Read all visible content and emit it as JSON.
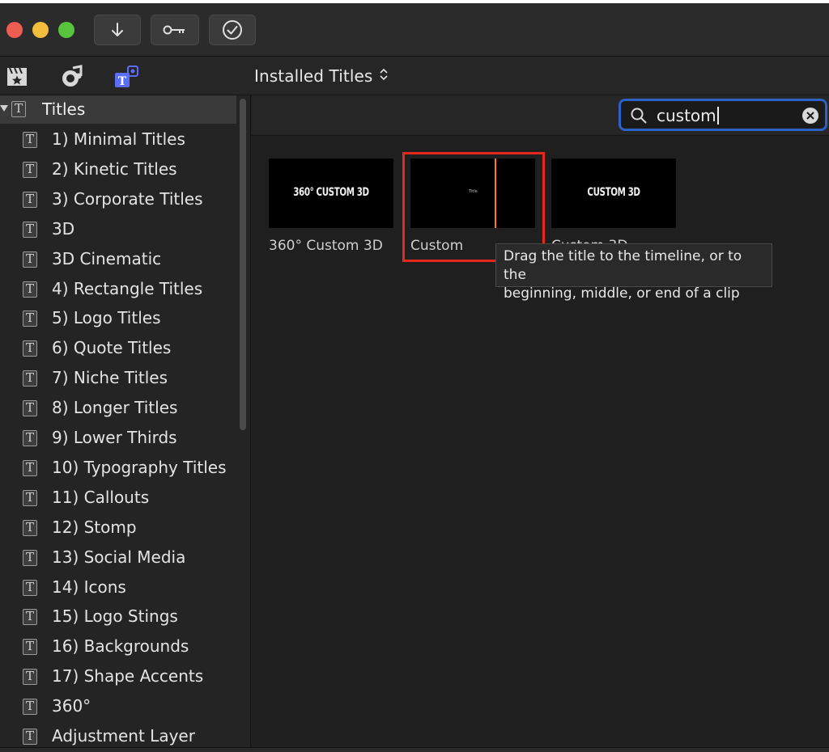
{
  "toolbar": {
    "buttons": [
      {
        "name": "import-button",
        "icon": "down-arrow-icon"
      },
      {
        "name": "keywords-button",
        "icon": "key-icon"
      },
      {
        "name": "background-tasks-button",
        "icon": "checkmark-circle-icon"
      }
    ]
  },
  "header": {
    "icons": [
      "photos-clapper-icon",
      "music-sound-icon",
      "titles-generators-icon"
    ],
    "browser_label": "Installed Titles"
  },
  "sidebar": {
    "root_label": "Titles",
    "items": [
      {
        "label": "1) Minimal Titles"
      },
      {
        "label": "2) Kinetic Titles"
      },
      {
        "label": "3) Corporate Titles"
      },
      {
        "label": "3D"
      },
      {
        "label": "3D Cinematic"
      },
      {
        "label": "4) Rectangle Titles"
      },
      {
        "label": "5) Logo Titles"
      },
      {
        "label": "6) Quote Titles"
      },
      {
        "label": "7) Niche Titles"
      },
      {
        "label": "8) Longer Titles"
      },
      {
        "label": "9) Lower Thirds"
      },
      {
        "label": "10) Typography Titles"
      },
      {
        "label": "11) Callouts"
      },
      {
        "label": "12) Stomp"
      },
      {
        "label": "13) Social Media"
      },
      {
        "label": "14) Icons"
      },
      {
        "label": "15) Logo Stings"
      },
      {
        "label": "16) Backgrounds"
      },
      {
        "label": "17) Shape Accents"
      },
      {
        "label": "360°"
      },
      {
        "label": "Adjustment Layer"
      }
    ]
  },
  "search": {
    "value": "custom"
  },
  "results": [
    {
      "caption": "360° Custom 3D",
      "thumb_text": "360° CUSTOM 3D"
    },
    {
      "caption": "Custom",
      "thumb_text": "Title"
    },
    {
      "caption": "Custom 3D",
      "thumb_text": "CUSTOM 3D"
    }
  ],
  "tooltip": {
    "line1": "Drag the title to the timeline, or to the",
    "line2": "beginning, middle, or end of a clip"
  },
  "colors": {
    "playhead": "#ff7a1a",
    "highlight_box": "#e6281e",
    "search_focus": "#2b62c6"
  }
}
